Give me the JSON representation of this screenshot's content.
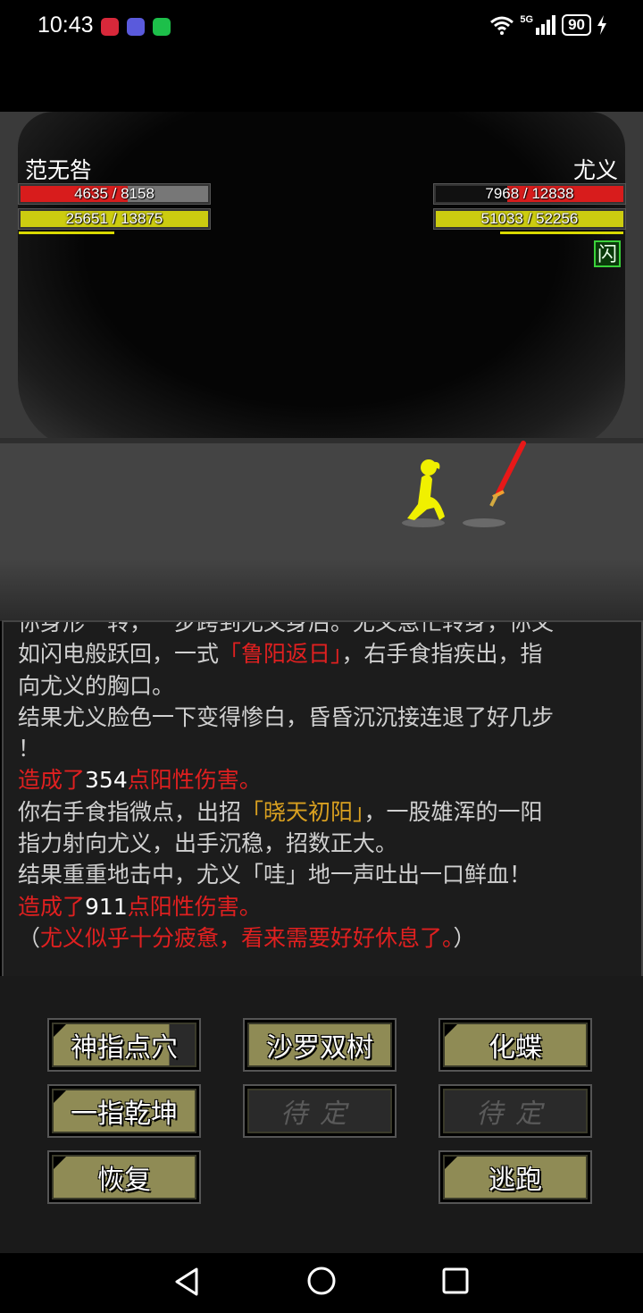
{
  "status_bar": {
    "time": "10:43",
    "network": "5G",
    "battery": "90"
  },
  "player": {
    "name": "范无咎",
    "hp": {
      "current": 4635,
      "max": 8158,
      "text": "4635 / 8158"
    },
    "mp": {
      "current": 25651,
      "max": 13875,
      "text": "25651 / 13875"
    },
    "stamina_fraction": 0.5
  },
  "enemy": {
    "name": "尤义",
    "hp": {
      "current": 7968,
      "max": 12838,
      "text": "7968 / 12838"
    },
    "mp": {
      "current": 51033,
      "max": 52256,
      "text": "51033 / 52256"
    },
    "stamina_fraction": 0.66,
    "status_icon_label": "闪"
  },
  "battle_log": [
    {
      "segments": [
        {
          "text": "你身形一转，一步跨到尤义身后。尤义急忙转身，你又",
          "color": "normal"
        }
      ]
    },
    {
      "segments": [
        {
          "text": "如闪电般跃回，一式",
          "color": "normal"
        },
        {
          "text": "「鲁阳返日」",
          "color": "red"
        },
        {
          "text": "，右手食指疾出，指",
          "color": "normal"
        }
      ]
    },
    {
      "segments": [
        {
          "text": "向尤义的胸口。",
          "color": "normal"
        }
      ]
    },
    {
      "segments": [
        {
          "text": "结果尤义脸色一下变得惨白，昏昏沉沉接连退了好几步",
          "color": "normal"
        }
      ]
    },
    {
      "segments": [
        {
          "text": "！",
          "color": "normal"
        }
      ]
    },
    {
      "segments": [
        {
          "text": "造成了",
          "color": "red"
        },
        {
          "text": "354",
          "color": "white"
        },
        {
          "text": "点阳性伤害。",
          "color": "red"
        }
      ]
    },
    {
      "segments": [
        {
          "text": "你右手食指微点，出招",
          "color": "normal"
        },
        {
          "text": "「晓天初阳」",
          "color": "gold"
        },
        {
          "text": "，一股雄浑的一阳",
          "color": "normal"
        }
      ]
    },
    {
      "segments": [
        {
          "text": "指力射向尤义，出手沉稳，招数正大。",
          "color": "normal"
        }
      ]
    },
    {
      "segments": [
        {
          "text": "结果重重地击中，尤义「哇」地一声吐出一口鲜血！",
          "color": "normal"
        }
      ]
    },
    {
      "segments": [
        {
          "text": "造成了",
          "color": "red"
        },
        {
          "text": "911",
          "color": "white"
        },
        {
          "text": "点阳性伤害。",
          "color": "red"
        }
      ]
    },
    {
      "segments": [
        {
          "text": "（",
          "color": "normal"
        },
        {
          "text": "尤义似乎十分疲惫，看来需要好好休息了。",
          "color": "red"
        },
        {
          "text": "）",
          "color": "normal"
        }
      ]
    }
  ],
  "actions": {
    "skill1": "神指点穴",
    "skill2": "沙罗双树",
    "skill3": "化蝶",
    "skill4": "一指乾坤",
    "skill5_disabled": "待定",
    "skill6_disabled": "待定",
    "recover": "恢复",
    "flee": "逃跑"
  },
  "colors": {
    "hp": "#d81c1c",
    "mp": "#cccc10",
    "button": "#8f8b55",
    "log_red": "#e02020",
    "log_gold": "#d9a020"
  },
  "icons": [
    "back-triangle-icon",
    "home-circle-icon",
    "recents-square-icon",
    "wifi-icon",
    "signal-icon",
    "charging-bolt-icon"
  ]
}
